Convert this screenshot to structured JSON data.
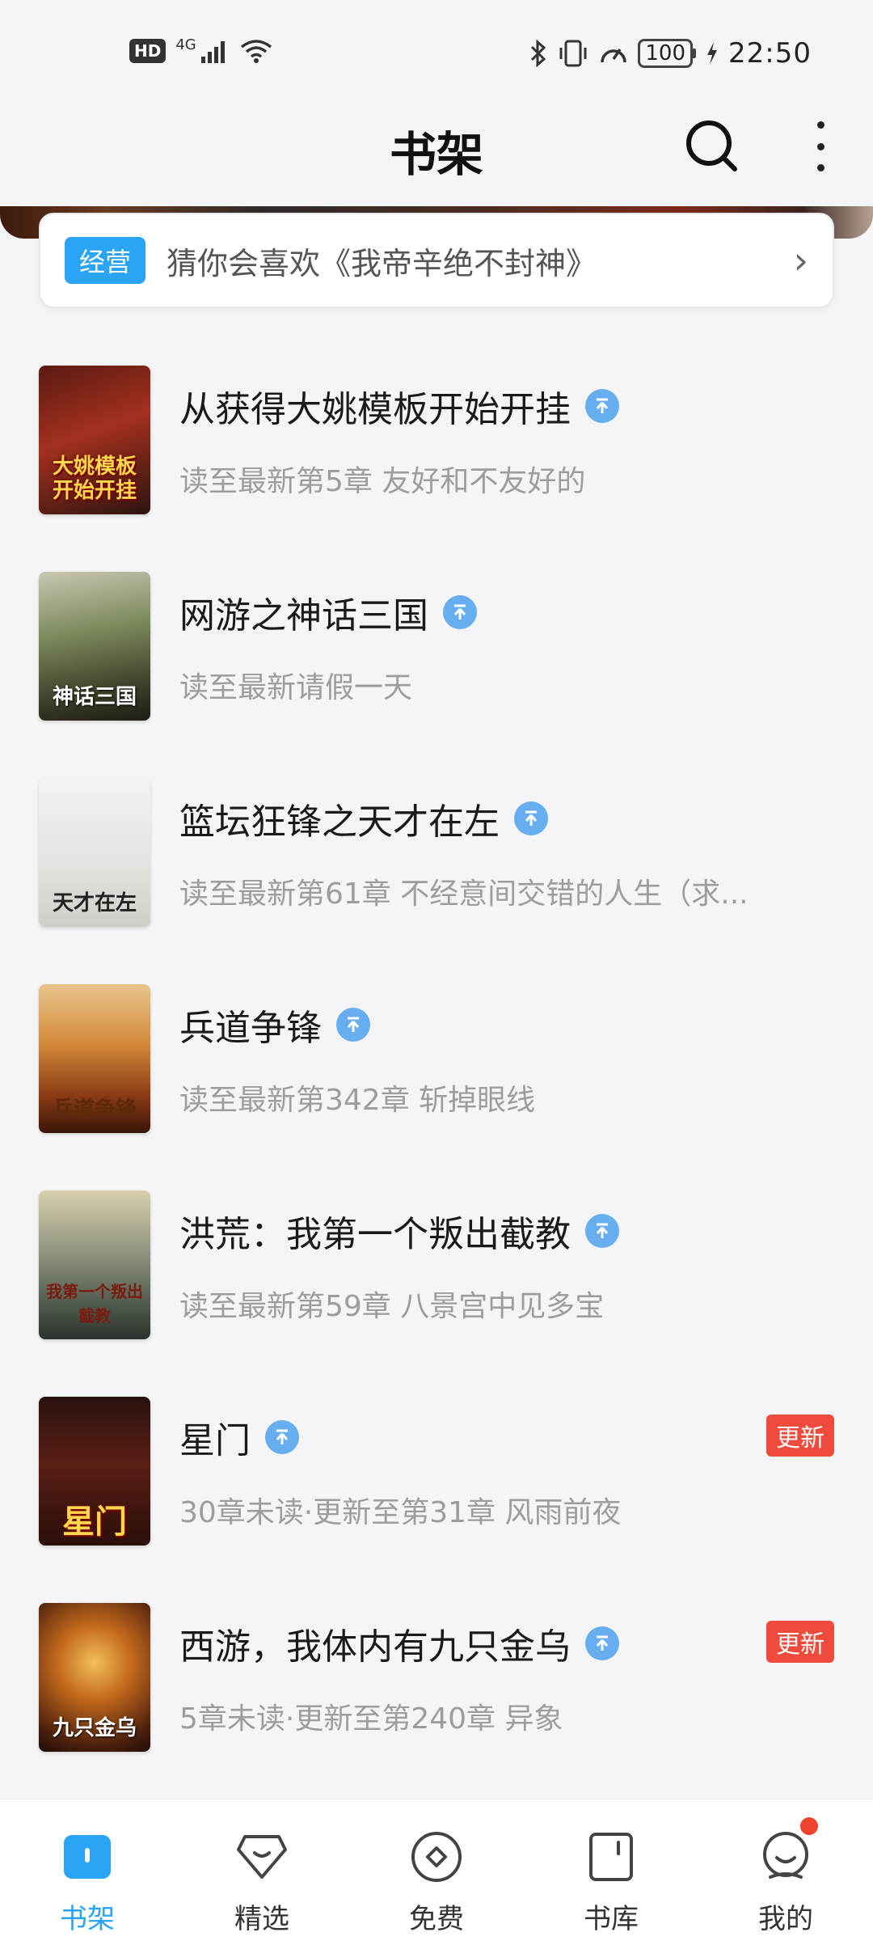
{
  "status_bar": {
    "hd": "HD",
    "network": "4G",
    "battery": "100",
    "time": "22:50"
  },
  "header": {
    "title": "书架"
  },
  "promo": {
    "tag": "经营",
    "text": "猜你会喜欢《我帝辛绝不封神》"
  },
  "books": [
    {
      "title": "从获得大姚模板开始开挂",
      "subtitle": "读至最新第5章 友好和不友好的",
      "badge": "",
      "cover_text": "大姚模板开始开挂"
    },
    {
      "title": "网游之神话三国",
      "subtitle": "读至最新请假一天",
      "badge": "",
      "cover_text": "神话三国"
    },
    {
      "title": "篮坛狂锋之天才在左",
      "subtitle": "读至最新第61章 不经意间交错的人生（求...",
      "badge": "",
      "cover_text": "天才在左"
    },
    {
      "title": "兵道争锋",
      "subtitle": "读至最新第342章 斩掉眼线",
      "badge": "",
      "cover_text": "兵道争锋"
    },
    {
      "title": "洪荒：我第一个叛出截教",
      "subtitle": "读至最新第59章 八景宫中见多宝",
      "badge": "",
      "cover_text": "我第一个叛出截教"
    },
    {
      "title": "星门",
      "subtitle": "30章未读·更新至第31章 风雨前夜",
      "badge": "更新",
      "cover_text": "星门"
    },
    {
      "title": "西游，我体内有九只金乌",
      "subtitle": "5章未读·更新至第240章 异象",
      "badge": "更新",
      "cover_text": "九只金乌"
    }
  ],
  "nav": [
    {
      "label": "书架",
      "icon": "bookshelf-icon",
      "active": true
    },
    {
      "label": "精选",
      "icon": "diamond-icon",
      "active": false
    },
    {
      "label": "免费",
      "icon": "free-icon",
      "active": false
    },
    {
      "label": "书库",
      "icon": "library-icon",
      "active": false
    },
    {
      "label": "我的",
      "icon": "profile-icon",
      "active": false
    }
  ],
  "colors": {
    "accent": "#2aa4f4",
    "badge_red": "#ee4b3c",
    "up_icon": "#67aef0"
  }
}
